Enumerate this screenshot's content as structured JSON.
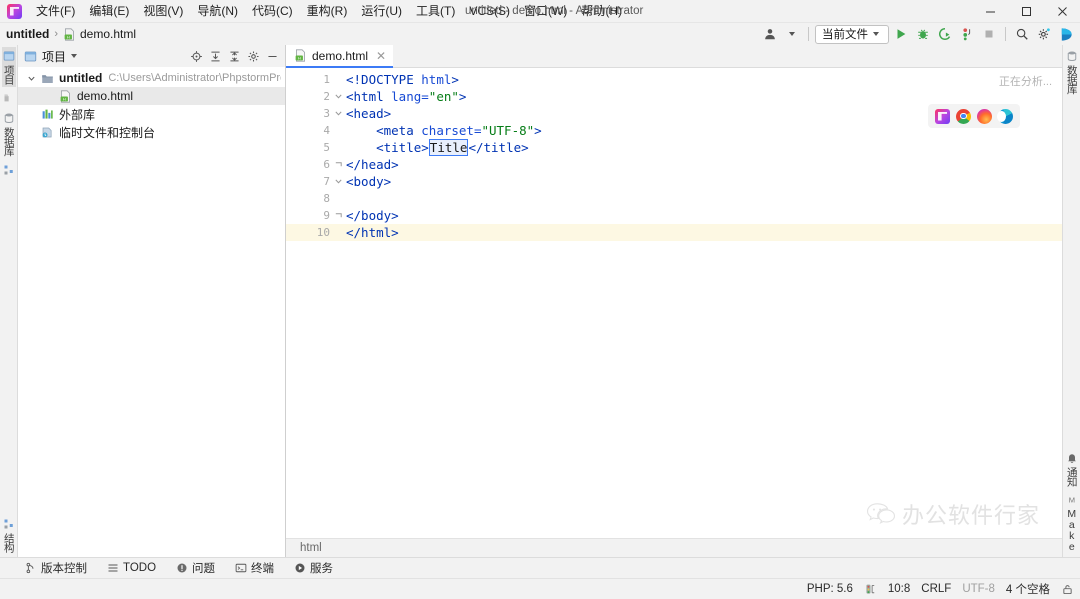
{
  "window": {
    "title": "untitled - demo.html - Administrator",
    "minimize_label": "–",
    "maximize_label": "□",
    "close_label": "✕",
    "logo_icon": "phpstorm-logo-icon"
  },
  "menubar": {
    "items": [
      {
        "label": "文件(F)",
        "name": "menu-file"
      },
      {
        "label": "编辑(E)",
        "name": "menu-edit"
      },
      {
        "label": "视图(V)",
        "name": "menu-view"
      },
      {
        "label": "导航(N)",
        "name": "menu-navigate"
      },
      {
        "label": "代码(C)",
        "name": "menu-code"
      },
      {
        "label": "重构(R)",
        "name": "menu-refactor"
      },
      {
        "label": "运行(U)",
        "name": "menu-run"
      },
      {
        "label": "工具(T)",
        "name": "menu-tools"
      },
      {
        "label": "VCS(S)",
        "name": "menu-vcs"
      },
      {
        "label": "窗口(W)",
        "name": "menu-window"
      },
      {
        "label": "帮助(H)",
        "name": "menu-help"
      }
    ]
  },
  "navbar": {
    "breadcrumb_project": "untitled",
    "breadcrumb_separator": "›",
    "breadcrumb_file": "demo.html",
    "run_config": "当前文件",
    "icons": [
      "user-avatar-icon",
      "run-icon",
      "debug-icon",
      "run-coverage-icon",
      "profiler-icon",
      "stop-icon",
      "search-everywhere-icon",
      "settings-gear-icon",
      "ide-assistant-icon"
    ]
  },
  "left_stripe": {
    "top": [
      {
        "label": "项目",
        "icon": "project-icon",
        "selected": true,
        "name": "stripe-project"
      },
      {
        "label": "",
        "icon": "commit-icon",
        "selected": false,
        "name": "stripe-commit"
      },
      {
        "label": "数据库",
        "icon": "database-icon",
        "selected": false,
        "name": "stripe-database"
      },
      {
        "label": "",
        "icon": "structure-icon",
        "selected": false,
        "name": "stripe-structure-top"
      }
    ],
    "bottom": [
      {
        "label": "结构",
        "icon": "structure-icon",
        "selected": false,
        "name": "stripe-structure"
      }
    ]
  },
  "right_stripe": {
    "top": [
      {
        "label": "数据库",
        "icon": "database-icon",
        "name": "stripe-right-database"
      }
    ],
    "bottom": [
      {
        "label": "通知",
        "icon": "bell-icon",
        "name": "stripe-notifications"
      },
      {
        "label": "Make",
        "icon": "make-icon",
        "name": "stripe-make"
      }
    ]
  },
  "project_panel": {
    "title": "项目",
    "title_icon": "project-window-icon",
    "dropdown_icon": "chevron-down-icon",
    "tools": [
      {
        "name": "locate-file-icon",
        "glyph": "locate"
      },
      {
        "name": "expand-all-icon",
        "glyph": "expand"
      },
      {
        "name": "collapse-all-icon",
        "glyph": "collapse"
      },
      {
        "name": "settings-gear-icon",
        "glyph": "gear"
      },
      {
        "name": "hide-panel-icon",
        "glyph": "minus"
      }
    ],
    "tree": [
      {
        "name": "tree-node-untitled",
        "label": "untitled",
        "path": "C:\\Users\\Administrator\\PhpstormProjects\\u",
        "icon": "folder-icon",
        "expanded": true,
        "indent": 0,
        "selected": false,
        "bold": true
      },
      {
        "name": "tree-node-demo-html",
        "label": "demo.html",
        "path": "",
        "icon": "html-file-icon",
        "expanded": false,
        "indent": 1,
        "selected": true,
        "bold": false
      },
      {
        "name": "tree-node-external-libraries",
        "label": "外部库",
        "path": "",
        "icon": "libraries-icon",
        "expanded": false,
        "indent": 0,
        "selected": false,
        "bold": false
      },
      {
        "name": "tree-node-scratches",
        "label": "临时文件和控制台",
        "path": "",
        "icon": "scratches-icon",
        "expanded": false,
        "indent": 0,
        "selected": false,
        "bold": false
      }
    ]
  },
  "editor": {
    "tab": {
      "label": "demo.html",
      "icon": "html-file-icon",
      "close": "✕"
    },
    "analyzing": "正在分析...",
    "browsers": [
      {
        "name": "browser-jetbrains-icon",
        "kind": "jb"
      },
      {
        "name": "browser-chrome-icon",
        "kind": "chrome"
      },
      {
        "name": "browser-firefox-icon",
        "kind": "firefox"
      },
      {
        "name": "browser-edge-icon",
        "kind": "edge"
      }
    ],
    "breadcrumb": "html",
    "current_line": 10,
    "lines": [
      {
        "n": 1,
        "fold": "",
        "indent": 0,
        "tokens": [
          {
            "t": "tag",
            "v": "<!DOCTYPE "
          },
          {
            "t": "attr",
            "v": "html"
          },
          {
            "t": "tag",
            "v": ">"
          }
        ]
      },
      {
        "n": 2,
        "fold": "open",
        "indent": 0,
        "tokens": [
          {
            "t": "tag",
            "v": "<html "
          },
          {
            "t": "attr",
            "v": "lang="
          },
          {
            "t": "val",
            "v": "\"en\""
          },
          {
            "t": "tag",
            "v": ">"
          }
        ]
      },
      {
        "n": 3,
        "fold": "open",
        "indent": 0,
        "tokens": [
          {
            "t": "tag",
            "v": "<head>"
          }
        ]
      },
      {
        "n": 4,
        "fold": "",
        "indent": 1,
        "tokens": [
          {
            "t": "tag",
            "v": "<meta "
          },
          {
            "t": "attr",
            "v": "charset="
          },
          {
            "t": "val",
            "v": "\"UTF-8\""
          },
          {
            "t": "tag",
            "v": ">"
          }
        ]
      },
      {
        "n": 5,
        "fold": "",
        "indent": 1,
        "tokens": [
          {
            "t": "tag",
            "v": "<title>"
          },
          {
            "t": "selected",
            "v": "Title"
          },
          {
            "t": "tag",
            "v": "</title>"
          }
        ]
      },
      {
        "n": 6,
        "fold": "close",
        "indent": 0,
        "tokens": [
          {
            "t": "tag",
            "v": "</head>"
          }
        ]
      },
      {
        "n": 7,
        "fold": "open",
        "indent": 0,
        "tokens": [
          {
            "t": "tag",
            "v": "<body>"
          }
        ]
      },
      {
        "n": 8,
        "fold": "",
        "indent": 0,
        "tokens": []
      },
      {
        "n": 9,
        "fold": "close",
        "indent": 0,
        "tokens": [
          {
            "t": "tag",
            "v": "</body>"
          }
        ]
      },
      {
        "n": 10,
        "fold": "close",
        "indent": 0,
        "tokens": [
          {
            "t": "tag",
            "v": "</html>"
          }
        ]
      }
    ]
  },
  "watermark": {
    "text": "办公软件行家",
    "icon": "wechat-icon"
  },
  "tool_window_bar": [
    {
      "label": "版本控制",
      "icon": "version-control-icon",
      "name": "toolwin-version-control"
    },
    {
      "label": "TODO",
      "icon": "todo-icon",
      "name": "toolwin-todo"
    },
    {
      "label": "问题",
      "icon": "problems-icon",
      "name": "toolwin-problems"
    },
    {
      "label": "终端",
      "icon": "terminal-icon",
      "name": "toolwin-terminal"
    },
    {
      "label": "服务",
      "icon": "services-icon",
      "name": "toolwin-services"
    }
  ],
  "status_bar": {
    "php_version": "PHP: 5.6",
    "interpreter_icon": "php-interpreter-icon",
    "caret_position": "10:8",
    "line_separator": "CRLF",
    "encoding": "UTF-8",
    "indent": "4 个空格",
    "lock_icon": "read-only-lock-icon"
  },
  "colors": {
    "accent": "#3c7bf6",
    "tag": "#0033b3",
    "attr": "#174ad4",
    "value": "#067d17",
    "current_line": "#fdf8e3",
    "chrome_bg": "#f2f2f2"
  }
}
